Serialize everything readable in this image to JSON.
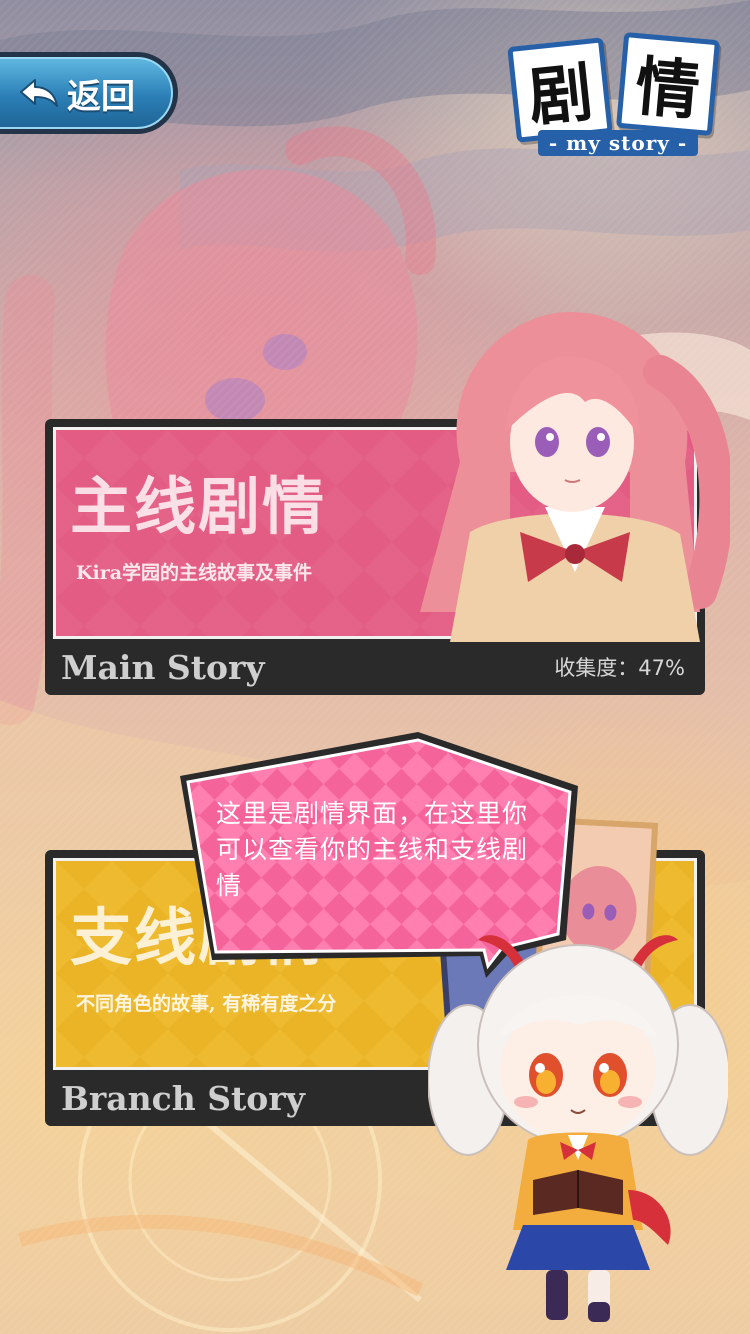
{
  "header": {
    "back_label": "返回",
    "logo": {
      "char_1": "剧",
      "char_2": "情",
      "subtitle": "- my story -"
    }
  },
  "main_story": {
    "title_cn": "主线剧情",
    "description": "Kira学园的主线故事及事件",
    "title_en": "Main Story",
    "progress": "收集度：47%",
    "accent_color": "#e25a80"
  },
  "branch_story": {
    "title_cn": "支线剧情",
    "description": "不同角色的故事, 有稀有度之分",
    "title_en": "Branch Story",
    "progress": "",
    "accent_color": "#ecb628"
  },
  "guide": {
    "dialogue": "这里是剧情界面，在这里你可以查看你的主线和支线剧情"
  },
  "icons": {
    "back": "back-arrow-icon"
  }
}
